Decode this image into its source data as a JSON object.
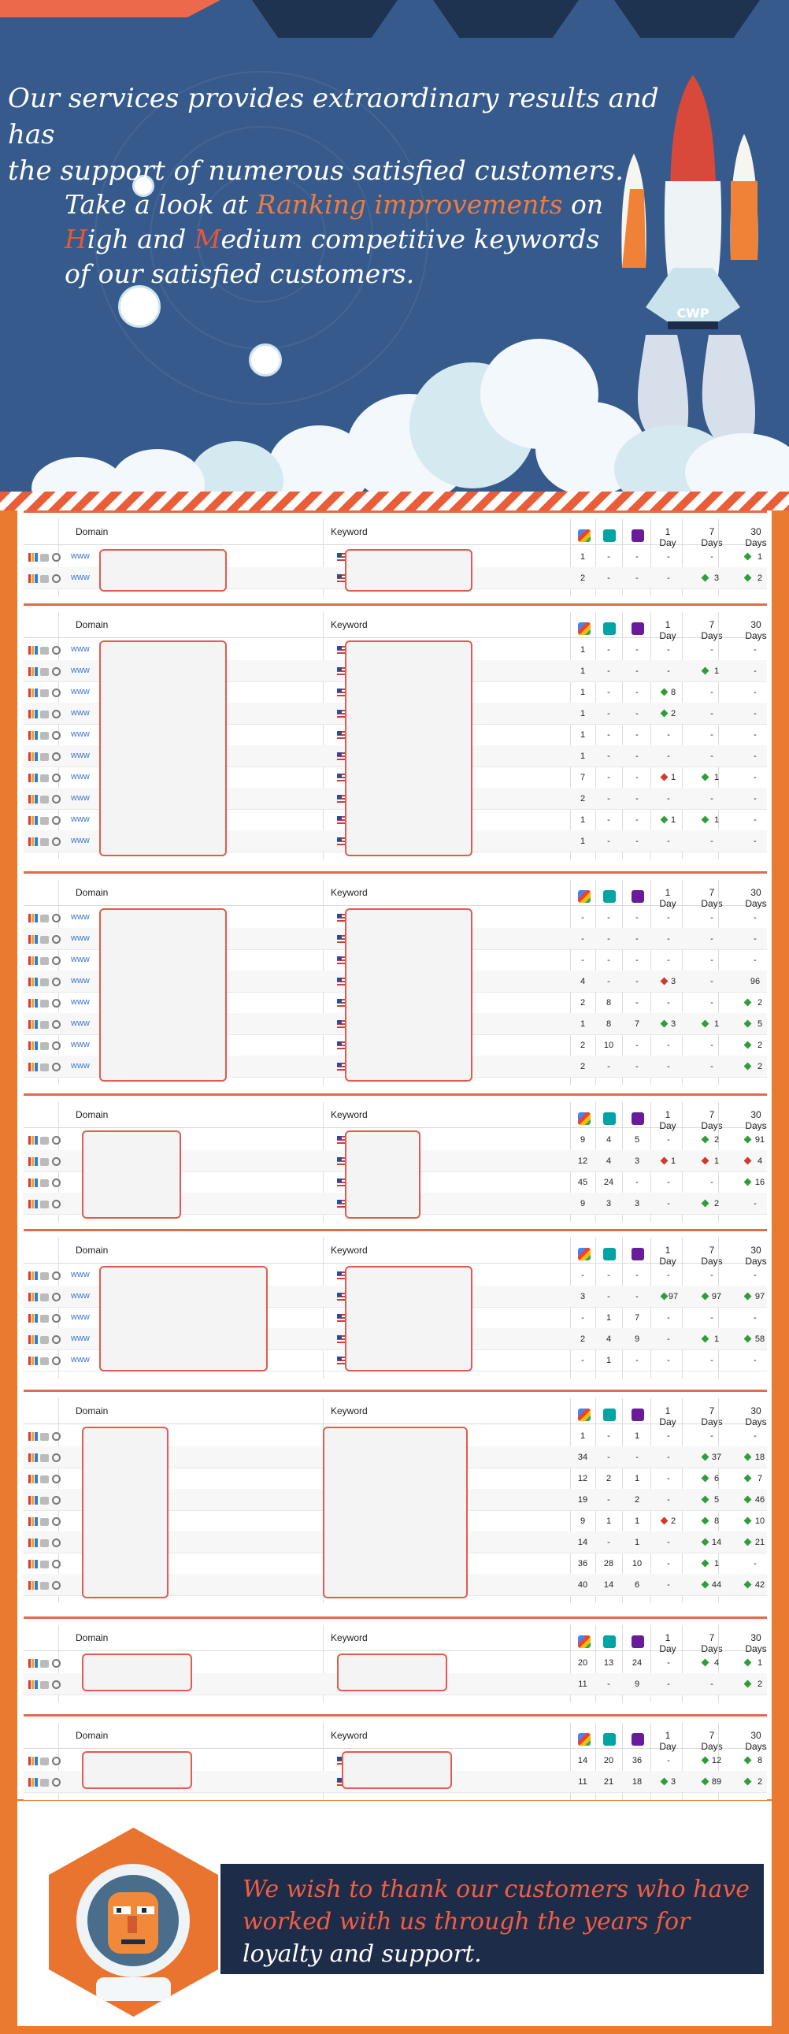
{
  "hero": {
    "headline_line1": "Our services provides extraordinary results and has",
    "headline_line2": "the support of numerous satisfied customers.",
    "sub_line1_a": "Take a look at ",
    "sub_line1_b": "Ranking improvements",
    "sub_line1_c": " on",
    "sub_line2_a": "H",
    "sub_line2_b": "igh and ",
    "sub_line2_c": "M",
    "sub_line2_d": "edium competitive keywords",
    "sub_line3": "of our satisfied customers.",
    "rocket_label": "CWP"
  },
  "table_header": {
    "domain": "Domain",
    "keyword": "Keyword",
    "day1": "1 Day",
    "day7": "7 Days",
    "day30": "30 Days"
  },
  "www_label": "www",
  "panels": [
    {
      "rows": [
        {
          "www": true,
          "g": "1",
          "b": "-",
          "y": "-",
          "d1": "-",
          "d7": "-",
          "d30": "1",
          "d30m": "up"
        },
        {
          "www": true,
          "g": "2",
          "b": "-",
          "y": "-",
          "d1": "-",
          "d7": "3",
          "d7m": "up",
          "d30": "2",
          "d30m": "up"
        }
      ]
    },
    {
      "rows": [
        {
          "www": true,
          "g": "1",
          "b": "-",
          "y": "-",
          "d1": "-",
          "d7": "-",
          "d30": "-"
        },
        {
          "www": true,
          "g": "1",
          "b": "-",
          "y": "-",
          "d1": "-",
          "d7": "1",
          "d7m": "up",
          "d30": "-"
        },
        {
          "www": true,
          "g": "1",
          "b": "-",
          "y": "-",
          "d1": "8",
          "d1m": "up",
          "d7": "-",
          "d30": "-"
        },
        {
          "www": true,
          "g": "1",
          "b": "-",
          "y": "-",
          "d1": "2",
          "d1m": "up",
          "d7": "-",
          "d30": "-"
        },
        {
          "www": true,
          "g": "1",
          "b": "-",
          "y": "-",
          "d1": "-",
          "d7": "-",
          "d30": "-"
        },
        {
          "www": true,
          "g": "1",
          "b": "-",
          "y": "-",
          "d1": "-",
          "d7": "-",
          "d30": "-"
        },
        {
          "www": true,
          "g": "7",
          "b": "-",
          "y": "-",
          "d1": "1",
          "d1m": "dn",
          "d7": "1",
          "d7m": "up",
          "d30": "-"
        },
        {
          "www": true,
          "g": "2",
          "b": "-",
          "y": "-",
          "d1": "-",
          "d7": "-",
          "d30": "-"
        },
        {
          "www": true,
          "g": "1",
          "b": "-",
          "y": "-",
          "d1": "1",
          "d1m": "up",
          "d7": "1",
          "d7m": "up",
          "d30": "-"
        },
        {
          "www": true,
          "g": "1",
          "b": "-",
          "y": "-",
          "d1": "-",
          "d7": "-",
          "d30": "-"
        }
      ]
    },
    {
      "rows": [
        {
          "www": true,
          "g": "-",
          "b": "-",
          "y": "-",
          "d1": "-",
          "d7": "-",
          "d30": "-"
        },
        {
          "www": true,
          "g": "-",
          "b": "-",
          "y": "-",
          "d1": "-",
          "d7": "-",
          "d30": "-"
        },
        {
          "www": true,
          "g": "-",
          "b": "-",
          "y": "-",
          "d1": "-",
          "d7": "-",
          "d30": "-"
        },
        {
          "www": true,
          "g": "4",
          "b": "-",
          "y": "-",
          "d1": "3",
          "d1m": "dn",
          "d7": "-",
          "d30": "96"
        },
        {
          "www": true,
          "g": "2",
          "b": "8",
          "y": "-",
          "d1": "-",
          "d7": "-",
          "d30": "2",
          "d30m": "up"
        },
        {
          "www": true,
          "g": "1",
          "b": "8",
          "y": "7",
          "d1": "3",
          "d1m": "up",
          "d7": "1",
          "d7m": "up",
          "d30": "5",
          "d30m": "up"
        },
        {
          "www": true,
          "g": "2",
          "b": "10",
          "y": "-",
          "d1": "-",
          "d7": "-",
          "d30": "2",
          "d30m": "up"
        },
        {
          "www": true,
          "g": "2",
          "b": "-",
          "y": "-",
          "d1": "-",
          "d7": "-",
          "d30": "2",
          "d30m": "up"
        }
      ]
    },
    {
      "rows": [
        {
          "www": false,
          "g": "9",
          "b": "4",
          "y": "5",
          "d1": "-",
          "d7": "2",
          "d7m": "up",
          "d30": "91",
          "d30m": "up"
        },
        {
          "www": false,
          "g": "12",
          "b": "4",
          "y": "3",
          "d1": "1",
          "d1m": "dn",
          "d7": "1",
          "d7m": "dn",
          "d30": "4",
          "d30m": "dn"
        },
        {
          "www": false,
          "g": "45",
          "b": "24",
          "y": "-",
          "d1": "-",
          "d7": "-",
          "d30": "16",
          "d30m": "up"
        },
        {
          "www": false,
          "g": "9",
          "b": "3",
          "y": "3",
          "d1": "-",
          "d7": "2",
          "d7m": "up",
          "d30": "-"
        }
      ]
    },
    {
      "rows": [
        {
          "www": true,
          "g": "-",
          "b": "-",
          "y": "-",
          "d1": "-",
          "d7": "-",
          "d30": "-"
        },
        {
          "www": true,
          "g": "3",
          "b": "-",
          "y": "-",
          "d1": "97",
          "d1m": "up",
          "d7": "97",
          "d7m": "up",
          "d30": "97",
          "d30m": "up"
        },
        {
          "www": true,
          "g": "-",
          "b": "1",
          "y": "7",
          "d1": "-",
          "d7": "-",
          "d30": "-"
        },
        {
          "www": true,
          "g": "2",
          "b": "4",
          "y": "9",
          "d1": "-",
          "d7": "1",
          "d7m": "up",
          "d30": "58",
          "d30m": "up"
        },
        {
          "www": true,
          "g": "-",
          "b": "1",
          "y": "-",
          "d1": "-",
          "d7": "-",
          "d30": "-"
        }
      ]
    },
    {
      "rows": [
        {
          "www": false,
          "g": "1",
          "b": "-",
          "y": "1",
          "d1": "-",
          "d7": "-",
          "d30": "-"
        },
        {
          "www": false,
          "g": "34",
          "b": "-",
          "y": "-",
          "d1": "-",
          "d7": "37",
          "d7m": "up",
          "d30": "18",
          "d30m": "up"
        },
        {
          "www": false,
          "g": "12",
          "b": "2",
          "y": "1",
          "d1": "-",
          "d7": "6",
          "d7m": "up",
          "d30": "7",
          "d30m": "up"
        },
        {
          "www": false,
          "g": "19",
          "b": "-",
          "y": "2",
          "d1": "-",
          "d7": "5",
          "d7m": "up",
          "d30": "46",
          "d30m": "up"
        },
        {
          "www": false,
          "g": "9",
          "b": "1",
          "y": "1",
          "d1": "2",
          "d1m": "dn",
          "d7": "8",
          "d7m": "up",
          "d30": "10",
          "d30m": "up"
        },
        {
          "www": false,
          "g": "14",
          "b": "-",
          "y": "1",
          "d1": "-",
          "d7": "14",
          "d7m": "up",
          "d30": "21",
          "d30m": "up"
        },
        {
          "www": false,
          "g": "36",
          "b": "28",
          "y": "10",
          "d1": "-",
          "d7": "1",
          "d7m": "up",
          "d30": "-"
        },
        {
          "www": false,
          "g": "40",
          "b": "14",
          "y": "6",
          "d1": "-",
          "d7": "44",
          "d7m": "up",
          "d30": "42",
          "d30m": "up"
        }
      ]
    },
    {
      "rows": [
        {
          "www": false,
          "g": "20",
          "b": "13",
          "y": "24",
          "d1": "-",
          "d7": "4",
          "d7m": "up",
          "d30": "1",
          "d30m": "up"
        },
        {
          "www": false,
          "g": "11",
          "b": "-",
          "y": "9",
          "d1": "-",
          "d7": "-",
          "d30": "2",
          "d30m": "up"
        }
      ]
    },
    {
      "rows": [
        {
          "www": false,
          "g": "14",
          "b": "20",
          "y": "36",
          "d1": "-",
          "d7": "12",
          "d7m": "up",
          "d30": "8",
          "d30m": "up"
        },
        {
          "www": false,
          "g": "11",
          "b": "21",
          "y": "18",
          "d1": "3",
          "d1m": "up",
          "d7": "89",
          "d7m": "up",
          "d30": "2",
          "d30m": "up"
        }
      ]
    }
  ],
  "thanks": {
    "line1": "We wish to thank our customers who have",
    "line2": "worked with us through the years for",
    "line3": "loyalty and support."
  },
  "colors": {
    "hero_bg": "#365a8c",
    "orange": "#eb7a31",
    "coral": "#e8563a",
    "navy": "#1d2c48",
    "rank_up": "#2f9e3a",
    "rank_down": "#d0392f"
  },
  "icons": [
    "bar-chart-icon",
    "tool-icon",
    "search-icon",
    "us-flag-icon",
    "google-icon",
    "bing-icon",
    "yahoo-icon",
    "rocket-illustration",
    "astronaut-illustration"
  ]
}
